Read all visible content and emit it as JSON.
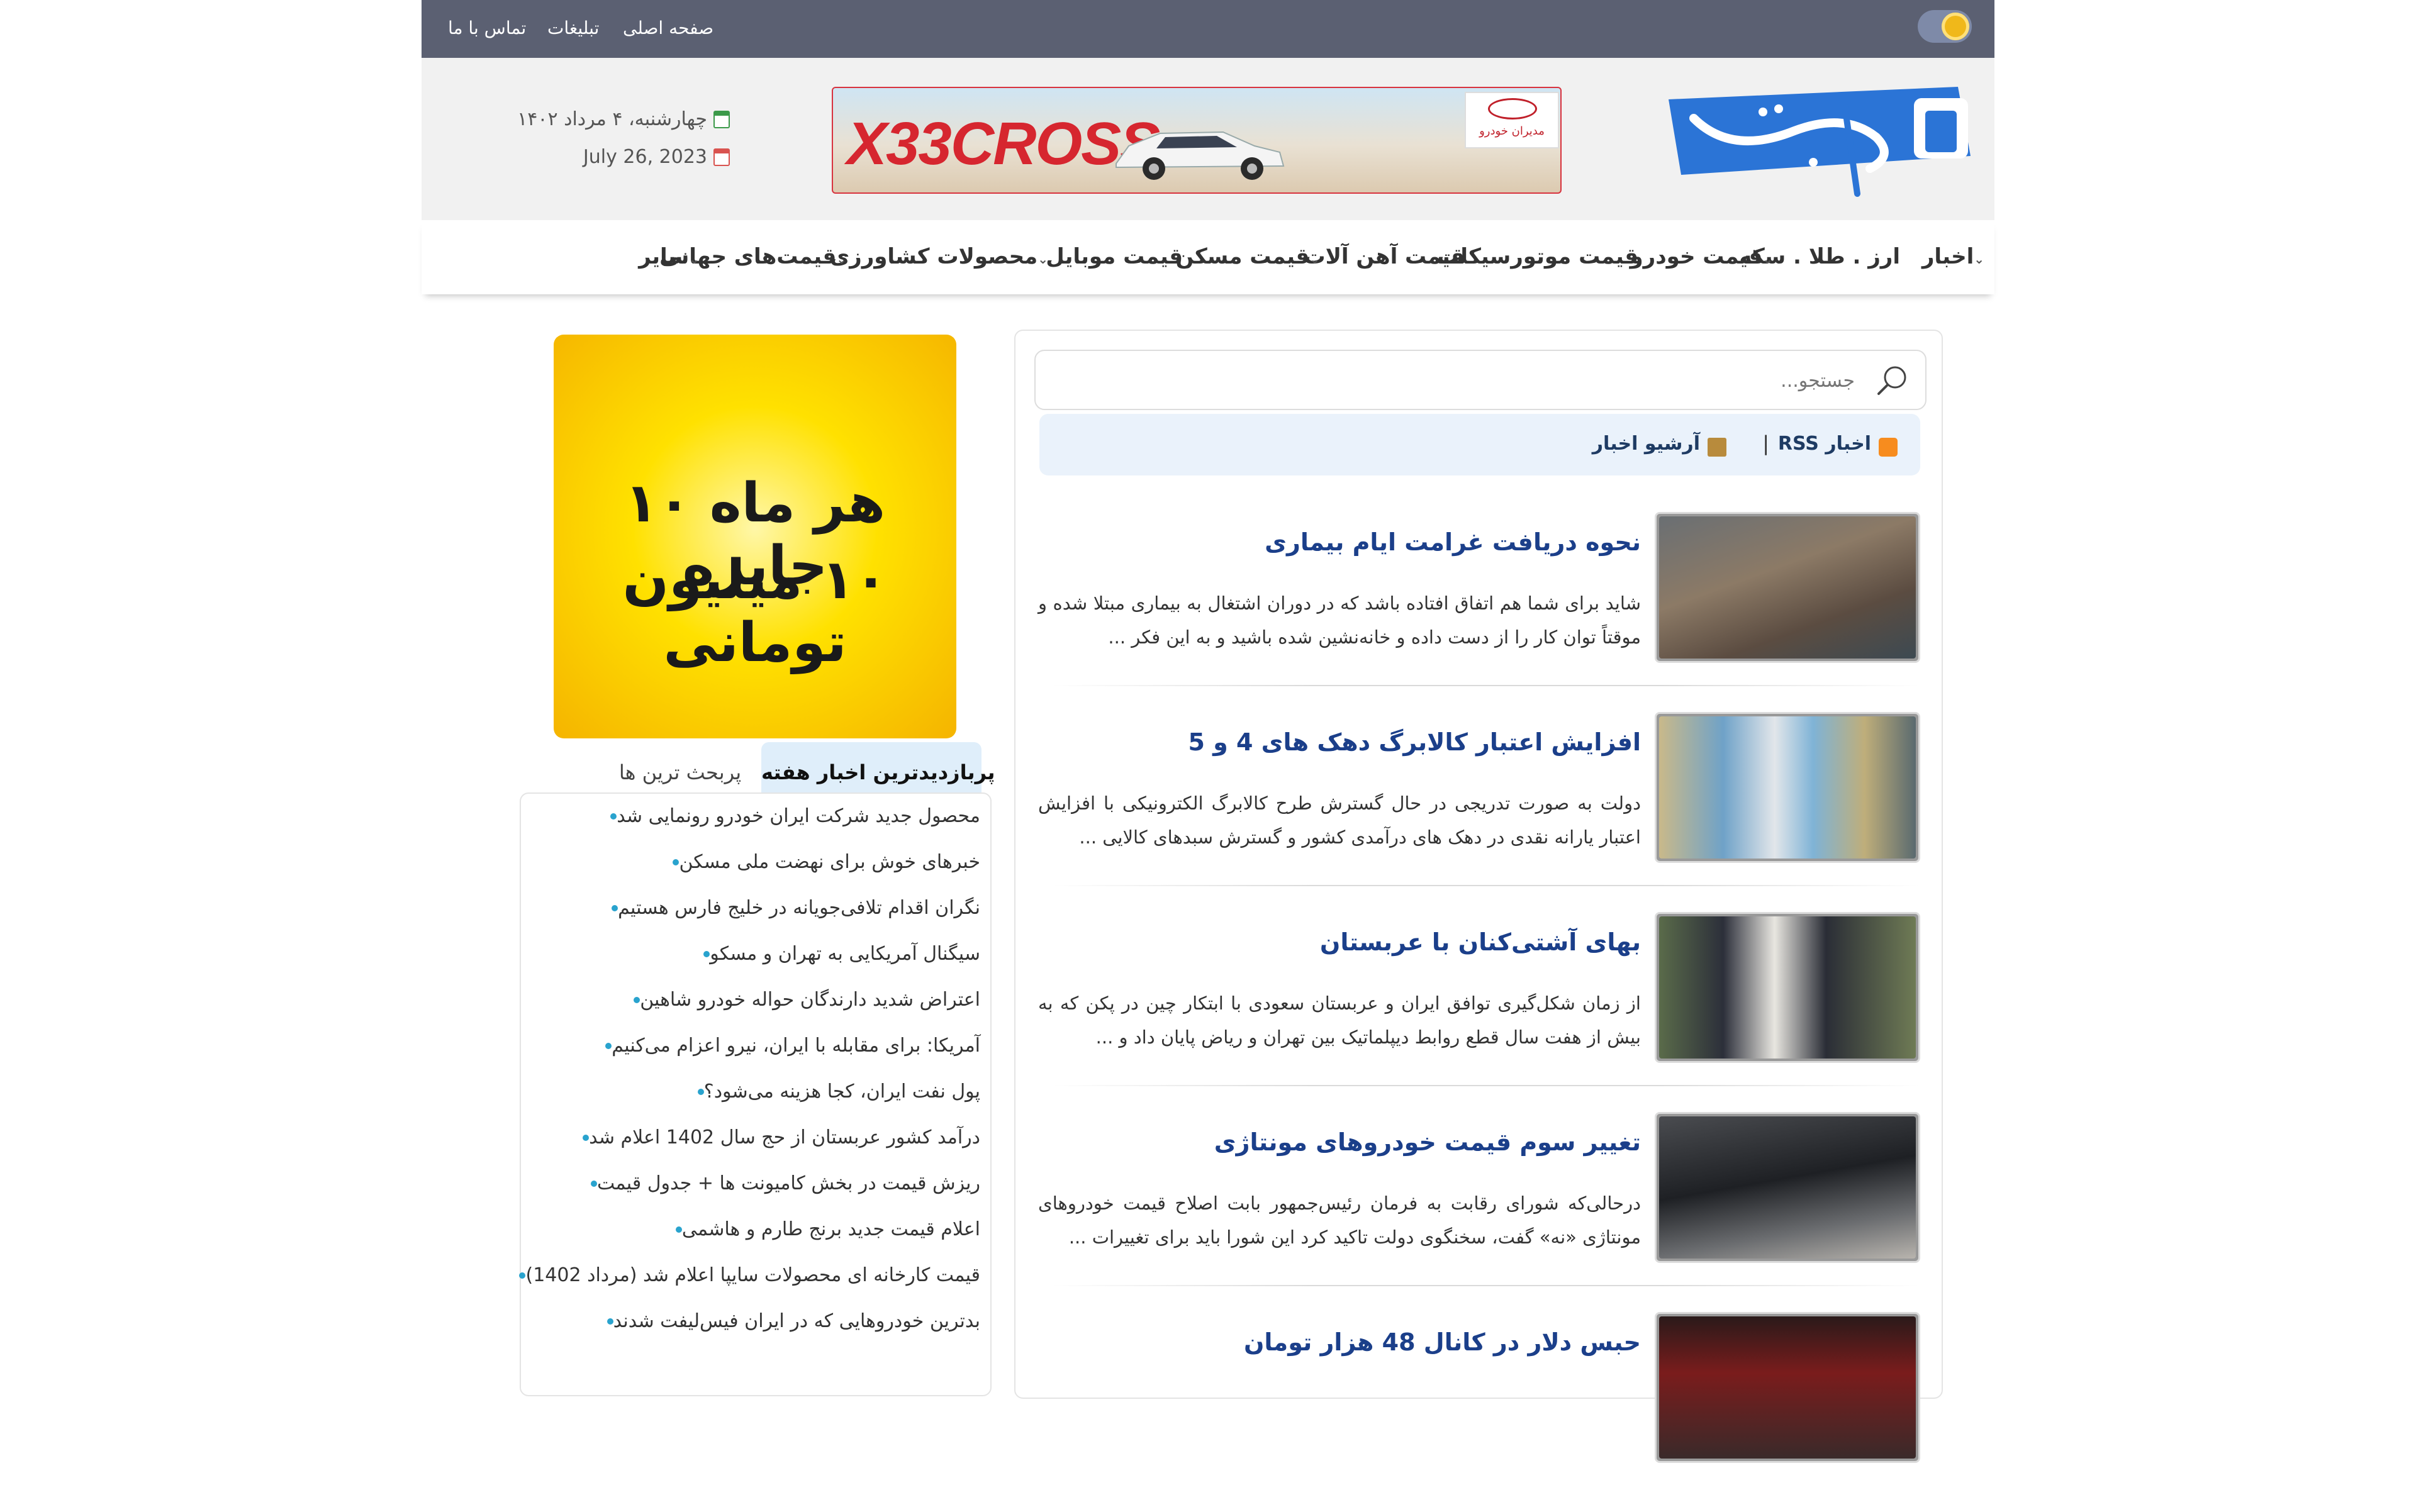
{
  "topbar": {
    "links": [
      "صفحه اصلی",
      "تبلیغات",
      "تماس با ما"
    ]
  },
  "header": {
    "date_fa": "چهارشنبه، ۴ مرداد ۱۴۰۲",
    "date_en": "July 26, 2023",
    "banner": {
      "brand": "X33CROSS",
      "dealer": "مدیران خودرو",
      "dealer_logo": "MVM"
    }
  },
  "nav": {
    "items": [
      {
        "label": "اخبار",
        "dropdown": true
      },
      {
        "label": "ارز . طلا . سکه",
        "dropdown": false
      },
      {
        "label": "قیمت خودرو",
        "dropdown": true
      },
      {
        "label": "قیمت موتورسیکلت",
        "dropdown": false
      },
      {
        "label": "قیمت آهن آلات",
        "dropdown": false
      },
      {
        "label": "قیمت مسکن",
        "dropdown": true
      },
      {
        "label": "قیمت موبایل",
        "dropdown": false
      },
      {
        "label": "محصولات کشاورزی",
        "dropdown": true
      },
      {
        "label": "قیمت‌های جهانی",
        "dropdown": true
      },
      {
        "label": "سایر",
        "dropdown": true
      }
    ]
  },
  "search": {
    "placeholder": "جستجو..."
  },
  "archive": {
    "rss": "RSS اخبار",
    "archive": "آرشیو اخبار"
  },
  "news": [
    {
      "title": "نحوه دریافت غرامت ایام بیماری",
      "excerpt": "شاید برای شما هم اتفاق افتاده باشد که در دوران اشتغال به بیماری مبتلا شده و موقتاً توان کار را از دست داده و خانه‌نشین شده باشید و به این فکر ..."
    },
    {
      "title": "افزایش اعتبار کالابرگ دهک های 4 و 5",
      "excerpt": "دولت به صورت تدریجی در حال گسترش طرح کالابرگ الکترونیکی با افزایش اعتبار یارانه نقدی در دهک های درآمدی کشور و گسترش سبدهای کالایی ..."
    },
    {
      "title": "بهای آشتی‌کنان با عربستان",
      "excerpt": "از زمان شکل‌گیری توافق ایران و عربستان سعودی با ابتکار چین در پکن که به بیش از هفت سال قطع روابط دیپلماتیک بین تهران و ریاض پایان داد و ..."
    },
    {
      "title": "تغییر سوم قیمت خودروهای مونتاژی",
      "excerpt": "درحالی‌که شورای رقابت به فرمان رئیس‌جمهور بابت اصلاح قیمت خودروهای مونتاژی «نه» گفت، سخنگوی دولت تاکید کرد این شورا باید برای تغییرات ..."
    },
    {
      "title": "حبس دلار در کانال 48 هزار تومان",
      "excerpt": ""
    }
  ],
  "sidebar": {
    "ad_line1": "هر ماه ۱۰ جایزه",
    "ad_line2": "۱۰ میلیون تومانی",
    "tab_active": "پربازدیدترین اخبار هفته",
    "tab_inactive": "پربحث ترین ها",
    "popular": [
      "محصول جدید شرکت ایران خودرو رونمایی شد",
      "خبرهای خوش برای نهضت ملی مسکن",
      "نگران اقدام تلافی‌جویانه در خلیج فارس هستیم",
      "سیگنال آمریکایی به تهران و مسکو",
      "اعتراض شدید دارندگان حواله خودرو شاهین",
      "آمریکا: برای مقابله با ایران، نیرو اعزام می‌کنیم",
      "پول نفت ایران، کجا هزینه می‌شود؟",
      "درآمد کشور عربستان از حج سال 1402 اعلام شد",
      "ریزش قیمت در بخش کامیونت ها + جدول قیمت",
      "اعلام قیمت جدید برنج طارم و هاشمی",
      "قیمت کارخانه ای محصولات سایپا اعلام شد (مرداد 1402)",
      "بدترین خودروهایی که در ایران فیس‌لیفت شدند"
    ]
  }
}
